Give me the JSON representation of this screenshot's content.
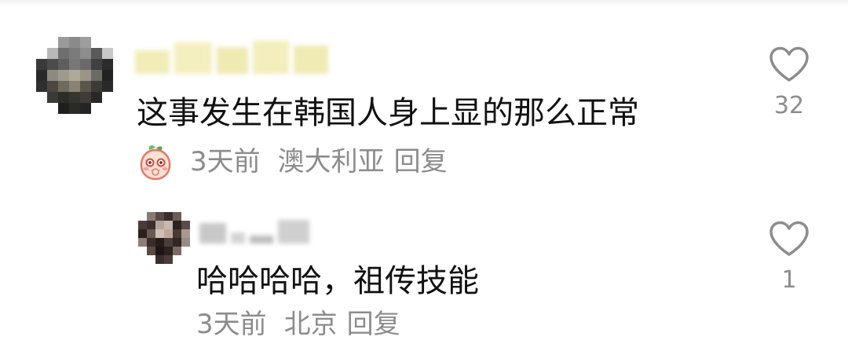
{
  "comment": {
    "text": "这事发生在韩国人身上显的那么正常",
    "time": "3天前",
    "location": "澳大利亚",
    "reply_label": "回复",
    "likes": "32",
    "sticker": "peach-sticker",
    "icons": {
      "like": "heart-outline-icon"
    }
  },
  "reply": {
    "text": "哈哈哈哈，祖传技能",
    "time": "3天前",
    "location": "北京",
    "reply_label": "回复",
    "likes": "1",
    "icons": {
      "like": "heart-outline-icon"
    }
  },
  "colors": {
    "text": "#111111",
    "meta": "#8c8c8c",
    "background": "#ffffff"
  }
}
